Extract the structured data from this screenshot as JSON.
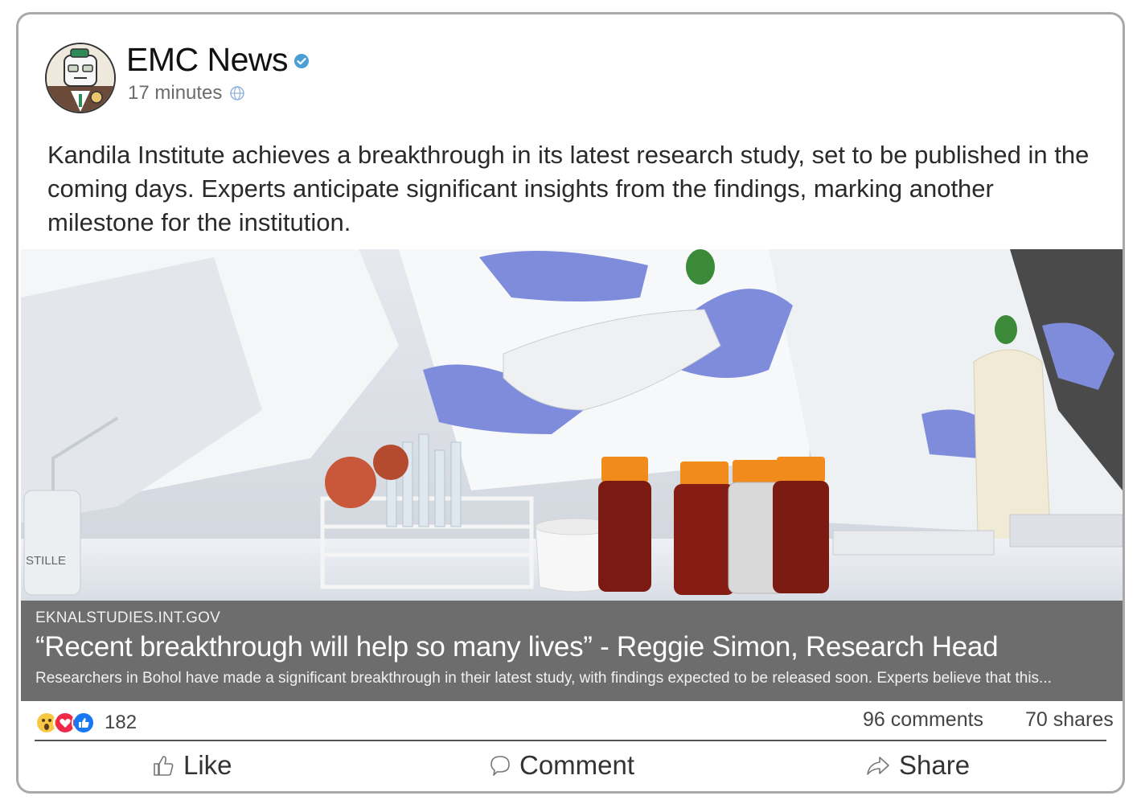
{
  "post": {
    "author": "EMC News",
    "time": "17 minutes",
    "text": "Kandila Institute achieves a breakthrough in its latest research study, set to be published in the coming days. Experts anticipate significant insights from the findings, marking another milestone for the institution."
  },
  "photo": {
    "bottle_label": "STILLE"
  },
  "link": {
    "domain": "EKNALSTUDIES.INT.GOV",
    "title": "“Recent breakthrough will help so many lives” - Reggie Simon, Research Head",
    "description": "Researchers in Bohol have made a significant breakthrough in their latest study, with findings expected to be released soon. Experts believe that this..."
  },
  "stats": {
    "reaction_icons": [
      "wow-icon",
      "love-icon",
      "like-icon"
    ],
    "reactions_count": "182",
    "comments": "96 comments",
    "shares": "70 shares"
  },
  "actions": {
    "like": "Like",
    "comment": "Comment",
    "share": "Share"
  },
  "colors": {
    "verified": "#4a9fd6",
    "link_box": "#6d6d6d",
    "like_blue": "#1877f2",
    "love_red": "#f0284a",
    "wow_yellow": "#f7c844",
    "glove": "#7f8cdc"
  }
}
